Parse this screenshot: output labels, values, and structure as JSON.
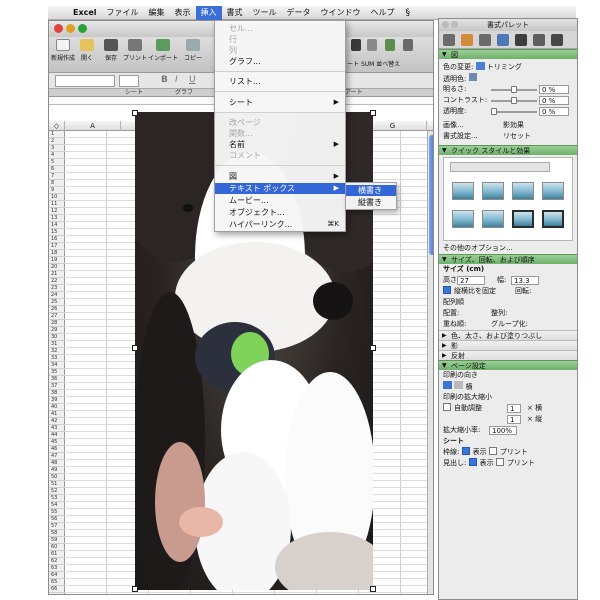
{
  "menubar": {
    "apple": "",
    "app_name": "Excel",
    "items": [
      "ファイル",
      "編集",
      "表示",
      "挿入",
      "書式",
      "ツール",
      "データ",
      "ウインドウ",
      "ヘルプ"
    ],
    "active_index": 3,
    "script_icon": "script-menu-icon"
  },
  "toolbar": {
    "buttons": [
      "新規作成",
      "開く",
      "保存",
      "プリント",
      "インポート",
      "コピー"
    ],
    "right_labels": [
      "ート",
      "SUM",
      "並べ替",
      "え"
    ]
  },
  "format_bar": {
    "font_name": "",
    "font_size": "",
    "bold": "B",
    "italic": "I",
    "underline": "U"
  },
  "ribbon_tabs": [
    "シート",
    "グラフ",
    "アート"
  ],
  "columns": [
    "A",
    "B",
    "C",
    "D",
    "E",
    "F",
    "G"
  ],
  "rows": [
    "1",
    "2",
    "3",
    "4",
    "5",
    "6",
    "7",
    "8",
    "9",
    "10",
    "11",
    "12",
    "13",
    "14",
    "15",
    "16",
    "17",
    "18",
    "19",
    "20",
    "21",
    "22",
    "23",
    "24",
    "25",
    "26",
    "27",
    "28",
    "29",
    "30",
    "31",
    "32",
    "33",
    "34",
    "35",
    "36",
    "37",
    "38",
    "39",
    "40",
    "41",
    "42",
    "43",
    "44",
    "45",
    "46",
    "47",
    "48",
    "49",
    "50",
    "51",
    "52",
    "53",
    "54",
    "55",
    "56",
    "57",
    "58",
    "59",
    "60",
    "61",
    "62",
    "63",
    "64",
    "65",
    "66"
  ],
  "insert_menu": {
    "items": [
      {
        "label": "セル...",
        "disabled": true
      },
      {
        "label": "行",
        "disabled": true
      },
      {
        "label": "列",
        "disabled": true
      },
      {
        "label": "グラフ...",
        "disabled": false
      },
      {
        "label": "リスト...",
        "disabled": false
      },
      {
        "label": "シート",
        "disabled": false,
        "submenu": true
      },
      {
        "label": "改ページ",
        "disabled": true
      },
      {
        "label": "関数...",
        "disabled": true
      },
      {
        "label": "名前",
        "disabled": false,
        "submenu": true
      },
      {
        "label": "コメント",
        "disabled": true
      },
      {
        "label": "図",
        "disabled": false,
        "submenu": true
      },
      {
        "label": "テキスト ボックス",
        "disabled": false,
        "submenu": true,
        "highlighted": true
      },
      {
        "label": "ムービー...",
        "disabled": false
      },
      {
        "label": "オブジェクト...",
        "disabled": false
      },
      {
        "label": "ハイパーリンク...",
        "disabled": false,
        "shortcut": "⌘K"
      }
    ],
    "submenu": [
      "横書き",
      "縦書き"
    ],
    "submenu_highlight": 0
  },
  "palette": {
    "title": "書式パレット",
    "sections": {
      "picture": "図",
      "quick_styles": "クイック スタイルと効果",
      "size": "サイズ、回転、および順序",
      "colors": "色、太さ、および塗りつぶし",
      "shadow": "影",
      "reflection": "反射",
      "page_setup": "ページ設定"
    },
    "recolor": "色の変更:",
    "crop": "トリミング",
    "transparent": "透明色:",
    "brightness": "明るさ:",
    "contrast": "コントラスト:",
    "transparency": "透明度:",
    "brightness_val": "0 %",
    "contrast_val": "0 %",
    "transparency_val": "0 %",
    "border_btn": "影効果",
    "effects_btn": "画像...",
    "format_pic": "書式設定...",
    "reset": "リセット",
    "more_options": "その他のオプション...",
    "size_label": "サイズ (cm)",
    "height_label": "高さ:",
    "height_val": "27",
    "width_label": "幅:",
    "width_val": "13.3",
    "lock_aspect": "縦横比を固定",
    "rotate": "回転:",
    "align_label": "配列順",
    "align": "配置:",
    "distribute": "整列:",
    "order": "重ね順:",
    "group": "グループ化:",
    "orientation_label": "印刷の向き",
    "orientation_val": "横",
    "scale_label": "印刷の拡大縮小",
    "auto_fit": "自動調整",
    "fit_w": "1",
    "fit_h": "1",
    "fit_w_unit": "× 横",
    "fit_h_unit": "× 縦",
    "zoom_label": "拡大縮小率:",
    "zoom_val": "100%",
    "sheet_label": "シート",
    "gridlines": "枠線:",
    "headings": "見出し:",
    "show": "表示",
    "print": "プリント"
  }
}
